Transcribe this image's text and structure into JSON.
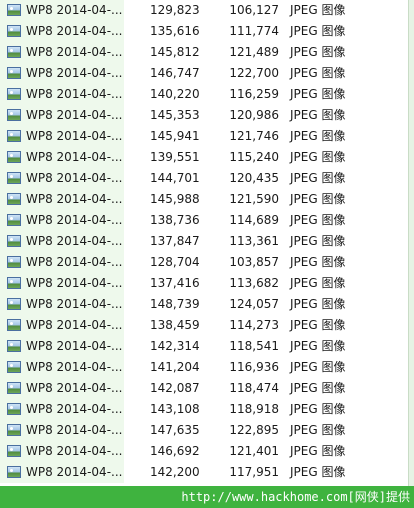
{
  "file_list": {
    "rows": [
      {
        "name": "WP8 2014-04-...",
        "size": "129,823",
        "packed": "106,127",
        "type": "JPEG 图像",
        "icon": "image-file-icon"
      },
      {
        "name": "WP8 2014-04-...",
        "size": "135,616",
        "packed": "111,774",
        "type": "JPEG 图像",
        "icon": "image-file-icon"
      },
      {
        "name": "WP8 2014-04-...",
        "size": "145,812",
        "packed": "121,489",
        "type": "JPEG 图像",
        "icon": "image-file-icon"
      },
      {
        "name": "WP8 2014-04-...",
        "size": "146,747",
        "packed": "122,700",
        "type": "JPEG 图像",
        "icon": "image-file-icon"
      },
      {
        "name": "WP8 2014-04-...",
        "size": "140,220",
        "packed": "116,259",
        "type": "JPEG 图像",
        "icon": "image-file-icon"
      },
      {
        "name": "WP8 2014-04-...",
        "size": "145,353",
        "packed": "120,986",
        "type": "JPEG 图像",
        "icon": "image-file-icon"
      },
      {
        "name": "WP8 2014-04-...",
        "size": "145,941",
        "packed": "121,746",
        "type": "JPEG 图像",
        "icon": "image-file-icon"
      },
      {
        "name": "WP8 2014-04-...",
        "size": "139,551",
        "packed": "115,240",
        "type": "JPEG 图像",
        "icon": "image-file-icon"
      },
      {
        "name": "WP8 2014-04-...",
        "size": "144,701",
        "packed": "120,435",
        "type": "JPEG 图像",
        "icon": "image-file-icon"
      },
      {
        "name": "WP8 2014-04-...",
        "size": "145,988",
        "packed": "121,590",
        "type": "JPEG 图像",
        "icon": "image-file-icon"
      },
      {
        "name": "WP8 2014-04-...",
        "size": "138,736",
        "packed": "114,689",
        "type": "JPEG 图像",
        "icon": "image-file-icon"
      },
      {
        "name": "WP8 2014-04-...",
        "size": "137,847",
        "packed": "113,361",
        "type": "JPEG 图像",
        "icon": "image-file-icon"
      },
      {
        "name": "WP8 2014-04-...",
        "size": "128,704",
        "packed": "103,857",
        "type": "JPEG 图像",
        "icon": "image-file-icon"
      },
      {
        "name": "WP8 2014-04-...",
        "size": "137,416",
        "packed": "113,682",
        "type": "JPEG 图像",
        "icon": "image-file-icon"
      },
      {
        "name": "WP8 2014-04-...",
        "size": "148,739",
        "packed": "124,057",
        "type": "JPEG 图像",
        "icon": "image-file-icon"
      },
      {
        "name": "WP8 2014-04-...",
        "size": "138,459",
        "packed": "114,273",
        "type": "JPEG 图像",
        "icon": "image-file-icon"
      },
      {
        "name": "WP8 2014-04-...",
        "size": "142,314",
        "packed": "118,541",
        "type": "JPEG 图像",
        "icon": "image-file-icon"
      },
      {
        "name": "WP8 2014-04-...",
        "size": "141,204",
        "packed": "116,936",
        "type": "JPEG 图像",
        "icon": "image-file-icon"
      },
      {
        "name": "WP8 2014-04-...",
        "size": "142,087",
        "packed": "118,474",
        "type": "JPEG 图像",
        "icon": "image-file-icon"
      },
      {
        "name": "WP8 2014-04-...",
        "size": "143,108",
        "packed": "118,918",
        "type": "JPEG 图像",
        "icon": "image-file-icon"
      },
      {
        "name": "WP8 2014-04-...",
        "size": "147,635",
        "packed": "122,895",
        "type": "JPEG 图像",
        "icon": "image-file-icon"
      },
      {
        "name": "WP8 2014-04-...",
        "size": "146,692",
        "packed": "121,401",
        "type": "JPEG 图像",
        "icon": "image-file-icon"
      },
      {
        "name": "WP8 2014-04-...",
        "size": "142,200",
        "packed": "117,951",
        "type": "JPEG 图像",
        "icon": "image-file-icon"
      }
    ]
  },
  "status_bar": {
    "watermark": "http://www.hackhome.com[网侠]提供"
  },
  "colors": {
    "name_column_bg": "#eef9ec",
    "status_bar_bg": "#3fb33f",
    "watermark_text": "#ffffff"
  }
}
